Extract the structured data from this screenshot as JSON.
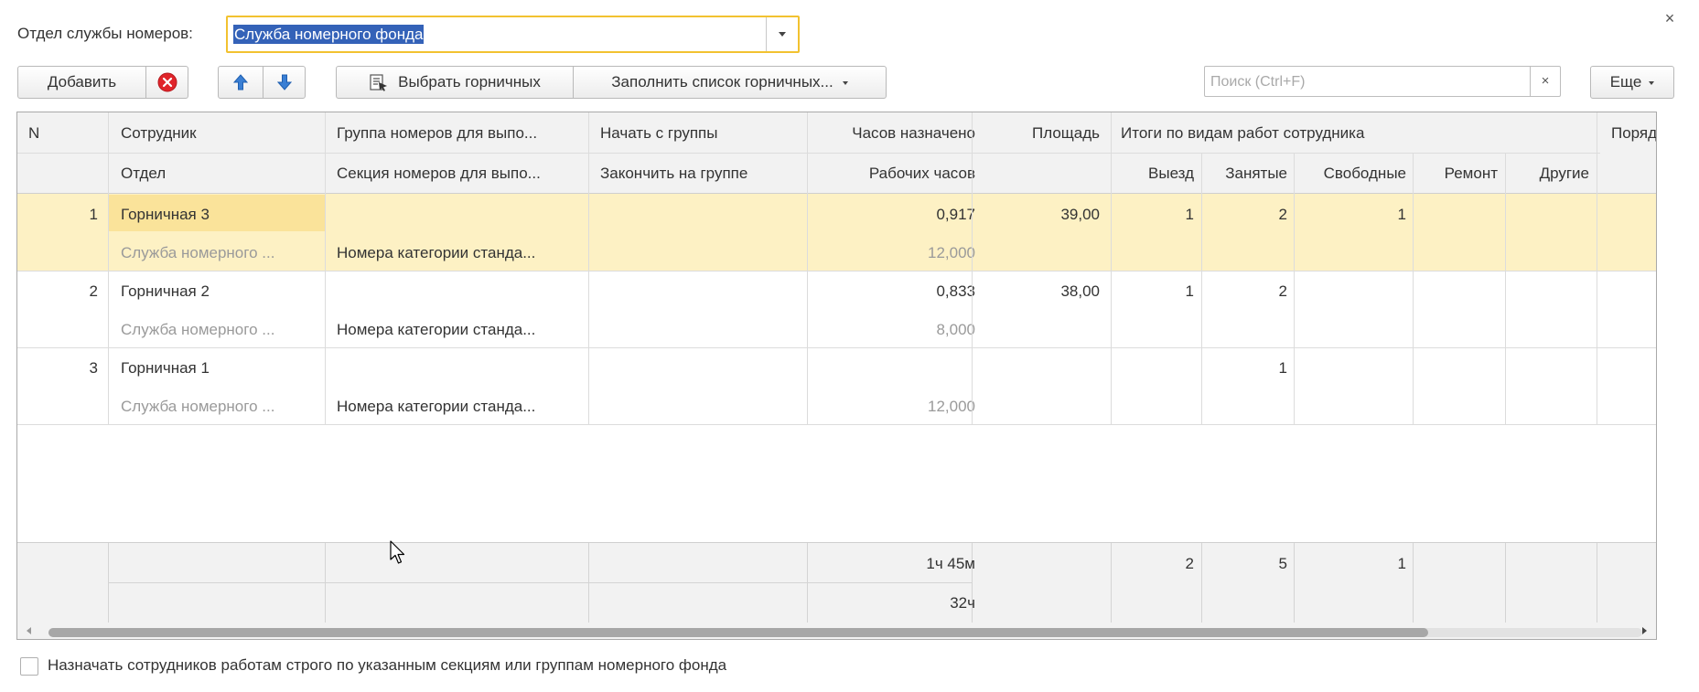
{
  "window": {
    "close_glyph": "×"
  },
  "department": {
    "label": "Отдел службы номеров:",
    "value": "Служба номерного фонда"
  },
  "toolbar": {
    "add_label": "Добавить",
    "select_maids_label": "Выбрать горничных",
    "fill_list_label": "Заполнить список горничных...",
    "more_label": "Еще"
  },
  "search": {
    "placeholder": "Поиск (Ctrl+F)",
    "value": "",
    "clear_glyph": "×"
  },
  "table": {
    "headers": {
      "n": "N",
      "employee": "Сотрудник",
      "department": "Отдел",
      "room_group": "Группа номеров для выпо...",
      "room_section": "Секция номеров для выпо...",
      "start_group": "Начать с группы",
      "end_group": "Закончить на группе",
      "hours_assigned": "Часов назначено",
      "work_hours": "Рабочих часов",
      "area": "Площадь",
      "totals_group": "Итоги по видам работ сотрудника",
      "checkout": "Выезд",
      "occupied": "Занятые",
      "free": "Свободные",
      "repair": "Ремонт",
      "other": "Другие",
      "order": "Поряд"
    },
    "rows": [
      {
        "n": "1",
        "employee": "Горничная 3",
        "department": "Служба номерного ...",
        "room_group": "",
        "room_section": "Номера категории станда...",
        "hours_assigned": "0,917",
        "work_hours": "12,000",
        "area": "39,00",
        "checkout": "1",
        "occupied": "2",
        "free": "1",
        "repair": "",
        "other": ""
      },
      {
        "n": "2",
        "employee": "Горничная 2",
        "department": "Служба номерного ...",
        "room_group": "",
        "room_section": "Номера категории станда...",
        "hours_assigned": "0,833",
        "work_hours": "8,000",
        "area": "38,00",
        "checkout": "1",
        "occupied": "2",
        "free": "",
        "repair": "",
        "other": ""
      },
      {
        "n": "3",
        "employee": "Горничная 1",
        "department": "Служба номерного ...",
        "room_group": "",
        "room_section": "Номера категории станда...",
        "hours_assigned": "",
        "work_hours": "12,000",
        "area": "",
        "checkout": "",
        "occupied": "1",
        "free": "",
        "repair": "",
        "other": ""
      }
    ],
    "totals": {
      "hours_assigned": "1ч 45м",
      "work_hours": "32ч",
      "checkout": "2",
      "occupied": "5",
      "free": "1"
    }
  },
  "options": {
    "strict_assign_label": "Назначать сотрудников работам строго по указанным секциям или группам номерного фонда"
  },
  "colors": {
    "selected_row": "#fdf1c4",
    "selected_cell": "#fae39a",
    "focus_border": "#f2c230",
    "text_selection": "#3462b8",
    "delete_icon": "#e0242a",
    "arrow_icon": "#3a7fd4"
  },
  "icons": {
    "delete": "delete-circle-icon",
    "up": "arrow-up-icon",
    "down": "arrow-down-icon",
    "select_maids": "select-list-icon",
    "dropdown": "chevron-down-icon",
    "close": "close-icon"
  }
}
